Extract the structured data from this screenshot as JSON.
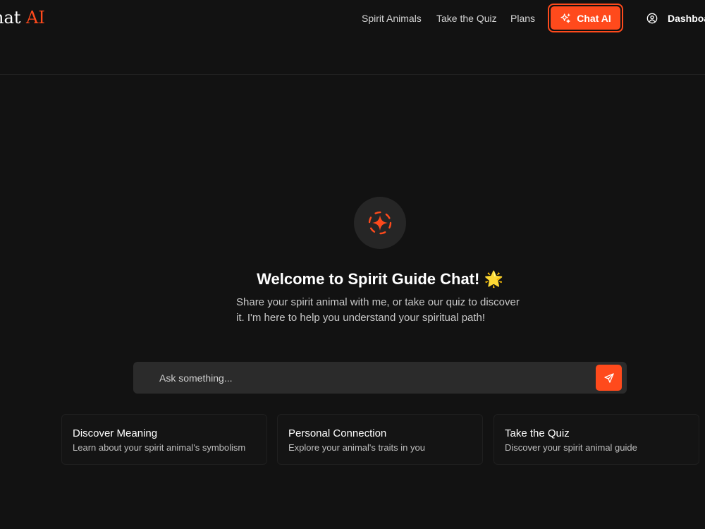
{
  "brand": {
    "logo_main": "hat ",
    "logo_accent": "AI",
    "accent_color": "#ff4a1c"
  },
  "nav": {
    "spirit_animals": "Spirit Animals",
    "take_quiz": "Take the Quiz",
    "plans": "Plans",
    "chat_ai": "Chat AI",
    "dashboard": "Dashboa"
  },
  "hero": {
    "icon": "sparkle-icon",
    "title": "Welcome to Spirit Guide Chat! 🌟",
    "subtitle": "Share your spirit animal with me, or take our quiz to discover it. I'm here to help you understand your spiritual path!"
  },
  "input": {
    "placeholder": "Ask something...",
    "value": "",
    "send_icon": "send-icon"
  },
  "cards": [
    {
      "title": "Discover Meaning",
      "description": "Learn about your spirit animal's symbolism"
    },
    {
      "title": "Personal Connection",
      "description": "Explore your animal's traits in you"
    },
    {
      "title": "Take the Quiz",
      "description": "Discover your spirit animal guide"
    }
  ]
}
